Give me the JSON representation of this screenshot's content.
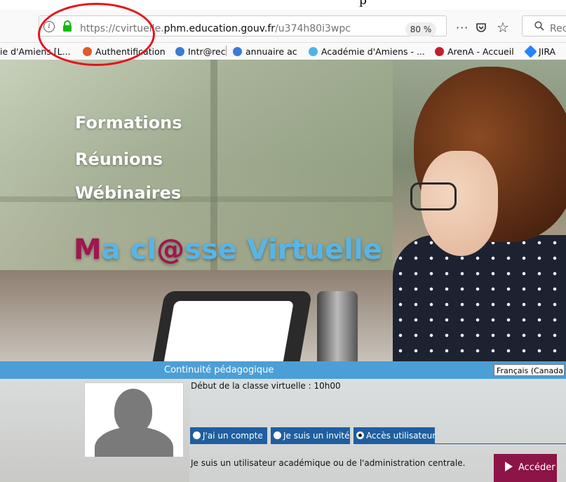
{
  "browser": {
    "top_cut_text": "p",
    "url_scheme": "https://cvirtuelle.",
    "url_domain": "phm.education.gouv.fr",
    "url_path": "/u374h80i3wpc",
    "zoom": "80 %",
    "more_label": "···",
    "search_placeholder": "Rec"
  },
  "bookmarks": [
    {
      "label": "ie d'Amiens [L...",
      "icon_color": "#cccccc"
    },
    {
      "label": "Authentification",
      "icon_color": "#e05a2b"
    },
    {
      "label": "Intr@rec",
      "icon_color": "#3a7bd5"
    },
    {
      "label": "annuaire ac",
      "icon_color": "#3a7bd5"
    },
    {
      "label": "Académie d'Amiens - ...",
      "icon_color": "#4fb3e8"
    },
    {
      "label": "ArenA - Accueil",
      "icon_color": "#c0202e"
    },
    {
      "label": "JIRA",
      "icon_color": "#2684ff"
    }
  ],
  "hero": {
    "line1": "Formations",
    "line2": "Réunions",
    "line3": "Wébinaires",
    "brand_m": "M",
    "brand_a": "a cl",
    "brand_at": "@",
    "brand_rest": "sse Virtuelle"
  },
  "bar": {
    "title": "Continuité pédagogique",
    "language": "Français (Canada)"
  },
  "session": {
    "start_text": "Début de la classe virtuelle : 10h00",
    "choices": [
      {
        "label": "J'ai un compte",
        "selected": false
      },
      {
        "label": "Je suis un invité",
        "selected": false
      },
      {
        "label": "Accès utilisateur",
        "selected": true
      }
    ],
    "description": "Je suis un utilisateur académique ou de l'administration centrale.",
    "access_button": "Accéder"
  },
  "colors": {
    "blue_bar": "#4b9fd6",
    "choice_bg": "#1f5fa0",
    "button_bg": "#8c1446",
    "brand_magenta": "#a0164f",
    "brand_blue": "#5ab4e4",
    "annotation_circle": "#e8121a"
  },
  "icons": [
    "info-icon",
    "lock-icon",
    "more-icon",
    "pocket-icon",
    "star-icon",
    "search-icon",
    "avatar-placeholder-icon",
    "play-icon"
  ]
}
